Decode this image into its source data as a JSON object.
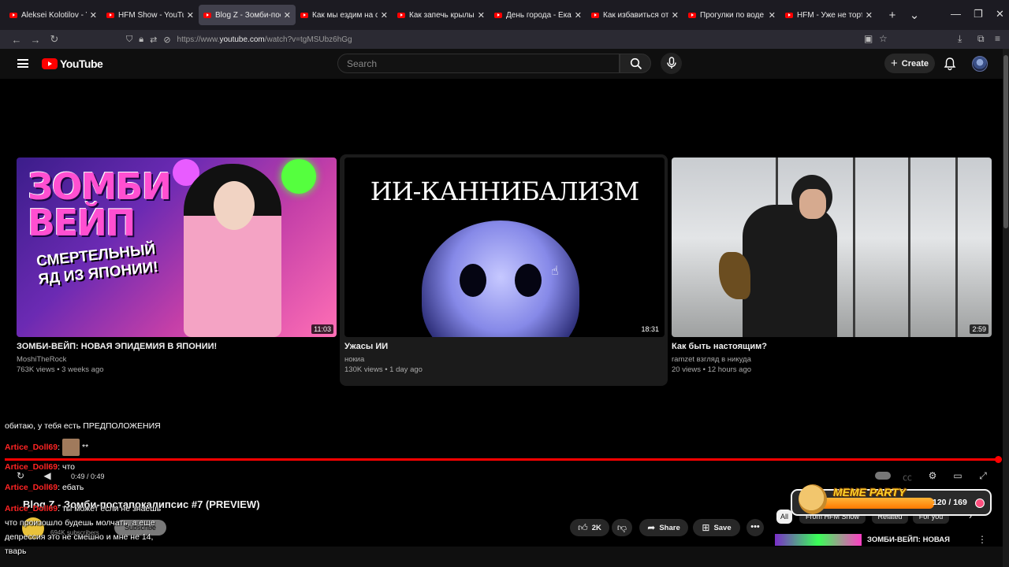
{
  "browser": {
    "tabs": [
      {
        "title": "Aleksei Kolotilov - YouTube",
        "active": false
      },
      {
        "title": "HFM Show - YouTube",
        "active": false
      },
      {
        "title": "Blog Z - Зомби-постапокалипсис",
        "active": true
      },
      {
        "title": "Как мы ездим на съемки",
        "active": false
      },
      {
        "title": "Как запечь крылышки",
        "active": false
      },
      {
        "title": "День города - Екатеринбург",
        "active": false
      },
      {
        "title": "Как избавиться от осени",
        "active": false
      },
      {
        "title": "Прогулки по воде - YouTube",
        "active": false
      },
      {
        "title": "HFM - Уже не торт - YouTube",
        "active": false
      }
    ],
    "url_prefix": "https://www.",
    "url_host": "youtube.com",
    "url_path": "/watch?v=tgMSUbz6hGg"
  },
  "youtube": {
    "logo_text": "YouTube",
    "search_placeholder": "Search",
    "create_label": "Create"
  },
  "end_cards": [
    {
      "title": "ЗОМБИ-ВЕЙП: НОВАЯ ЭПИДЕМИЯ В ЯПОНИИ!",
      "channel": "MoshiTheRock",
      "meta": "763K views • 3 weeks ago",
      "duration": "11:03",
      "thumb_big": "ЗОМБИ ВЕЙП",
      "thumb_sub": "СМЕРТЕЛЬНЫЙ ЯД ИЗ ЯПОНИИ!"
    },
    {
      "title": "Ужасы ИИ",
      "channel": "нокиа",
      "meta": "130K views • 1 day ago",
      "duration": "18:31",
      "thumb_caption": "ИИ-КАННИБАЛИЗМ"
    },
    {
      "title": "Как быть настоящим?",
      "channel": "ramzet взгляд в никуда",
      "meta": "20 views • 12 hours ago",
      "duration": "2:59"
    }
  ],
  "player": {
    "time": "0:49 / 0:49",
    "progress": 1.0
  },
  "video": {
    "title": "Blog Z - Зомби-постапокалипсис #7 (PREVIEW)",
    "subscribers": "694K subscribers",
    "subscribe_label": "Subscribe",
    "likes": "2K",
    "share_label": "Share",
    "save_label": "Save"
  },
  "sidebar": {
    "chips": [
      "All",
      "From HFM Show",
      "Related",
      "For you"
    ],
    "first_item_title": "ЗОМБИ-ВЕЙП: НОВАЯ"
  },
  "meme_party": {
    "label": "MEME PARTY",
    "count": "120 / 169"
  },
  "chat": [
    {
      "user": "",
      "text": "обитаю, у тебя есть ПРЕДПОЛОЖЕНИЯ"
    },
    {
      "user": "Artice_Doll69",
      "text": "**",
      "avatar": true
    },
    {
      "user": "Artice_Doll69",
      "text": "что"
    },
    {
      "user": "Artice_Doll69",
      "text": "ебать"
    },
    {
      "user": "Artice_Doll69",
      "text": "ты может если не знаешь"
    },
    {
      "user": "",
      "text": "что произошло будешь молчать, а еще"
    },
    {
      "user": "",
      "text": "депрессия это не смешно и мне не 14,"
    },
    {
      "user": "",
      "text": "тварь"
    }
  ],
  "colors": {
    "youtube_red": "#ff0000",
    "background": "#0f0f0f",
    "chat_user": "#ff2424",
    "meme_bar": "#ff9a1a"
  }
}
